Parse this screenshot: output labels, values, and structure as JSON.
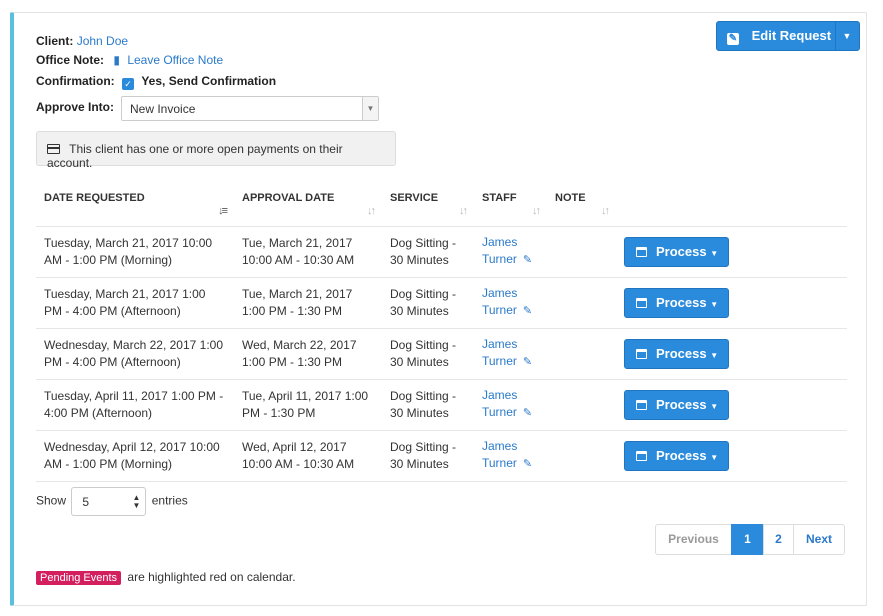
{
  "client": {
    "label": "Client:",
    "value": "John Doe"
  },
  "office_note": {
    "label": "Office Note:",
    "link": "Leave Office Note"
  },
  "confirmation": {
    "label": "Confirmation:",
    "value": "Yes, Send Confirmation",
    "checked": true
  },
  "approve_into": {
    "label": "Approve Into:",
    "selected": "New Invoice"
  },
  "alert_text": "This client has one or more open payments on their account.",
  "edit_button": {
    "label": "Edit Request"
  },
  "table": {
    "headers": [
      "DATE REQUESTED",
      "APPROVAL DATE",
      "SERVICE",
      "STAFF",
      "NOTE"
    ],
    "rows": [
      {
        "date_line1": "Tuesday, March 21, 2017 10:00",
        "date_line2": "AM - 1:00 PM (Morning)",
        "approval_line1": "Tue, March 21, 2017",
        "approval_line2": "10:00 AM - 10:30 AM",
        "service_line1": "Dog Sitting -",
        "service_line2": "30 Minutes",
        "staff_line1": "James",
        "staff_line2": "Turner",
        "note": "",
        "action": "Process"
      },
      {
        "date_line1": "Tuesday, March 21, 2017 1:00",
        "date_line2": "PM - 4:00 PM (Afternoon)",
        "approval_line1": "Tue, March 21, 2017",
        "approval_line2": "1:00 PM - 1:30 PM",
        "service_line1": "Dog Sitting -",
        "service_line2": "30 Minutes",
        "staff_line1": "James",
        "staff_line2": "Turner",
        "note": "",
        "action": "Process"
      },
      {
        "date_line1": "Wednesday, March 22, 2017 1:00",
        "date_line2": "PM - 4:00 PM (Afternoon)",
        "approval_line1": "Wed, March 22, 2017",
        "approval_line2": "1:00 PM - 1:30 PM",
        "service_line1": "Dog Sitting -",
        "service_line2": "30 Minutes",
        "staff_line1": "James",
        "staff_line2": "Turner",
        "note": "",
        "action": "Process"
      },
      {
        "date_line1": "Tuesday, April 11, 2017 1:00 PM -",
        "date_line2": "4:00 PM (Afternoon)",
        "approval_line1": "Tue, April 11, 2017 1:00",
        "approval_line2": "PM - 1:30 PM",
        "service_line1": "Dog Sitting -",
        "service_line2": "30 Minutes",
        "staff_line1": "James",
        "staff_line2": "Turner",
        "note": "",
        "action": "Process"
      },
      {
        "date_line1": "Wednesday, April 12, 2017 10:00",
        "date_line2": "AM - 1:00 PM (Morning)",
        "approval_line1": "Wed, April 12, 2017",
        "approval_line2": "10:00 AM - 10:30 AM",
        "service_line1": "Dog Sitting -",
        "service_line2": "30 Minutes",
        "staff_line1": "James",
        "staff_line2": "Turner",
        "note": "",
        "action": "Process"
      }
    ]
  },
  "length_menu": {
    "prefix": "Show",
    "value": "5",
    "suffix": "entries"
  },
  "pagination": {
    "previous": "Previous",
    "pages": [
      "1",
      "2"
    ],
    "current": "1",
    "next": "Next"
  },
  "footer": {
    "badge": "Pending Events",
    "text": "are highlighted red on calendar."
  },
  "colors": {
    "accent": "#2a8bdc",
    "panel_border": "#5bc0de",
    "badge": "#d41f5e",
    "link": "#2a7ac9"
  }
}
